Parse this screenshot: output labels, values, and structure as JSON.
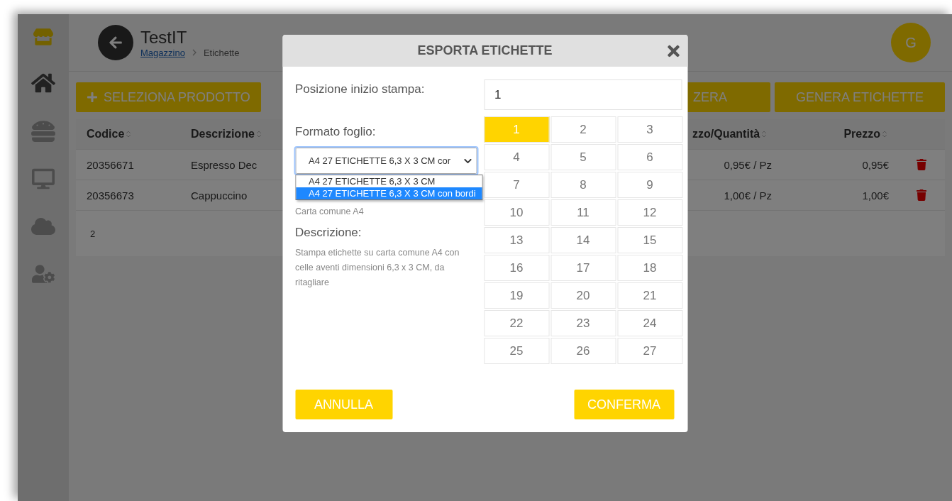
{
  "header": {
    "title": "TestIT",
    "breadcrumb": [
      {
        "label": "Magazzino",
        "link": true
      },
      {
        "label": "Etichette",
        "link": false
      }
    ],
    "avatar": "G"
  },
  "toolbar": {
    "add_button": "SELEZIONA PRODOTTO",
    "buttons": [
      "ZERA",
      "GENERA ETICHETTE"
    ]
  },
  "table": {
    "columns": [
      "Codice",
      "Descrizione",
      "zzo/Quantità",
      "Prezzo"
    ],
    "rows": [
      [
        "20356671",
        "Espresso Dec",
        "0,95€ / Pz",
        "0,95€"
      ],
      [
        "20356673",
        "Cappuccino",
        "1,00€ / Pz",
        "1,00€"
      ]
    ],
    "footer": "2"
  },
  "dialog": {
    "title": "ESPORTA ETICHETTE",
    "start_label": "Posizione inizio stampa:",
    "start_value": "1",
    "format_label": "Formato foglio:",
    "format_value": "A4 27 ETICHETTE 6,3 X 3 CM cor",
    "format_options": [
      {
        "label": "A4 27 ETICHETTE 6,3 X 3 CM",
        "selected": false
      },
      {
        "label": "A4 27 ETICHETTE 6,3 X 3 CM con bordi",
        "selected": true
      }
    ],
    "paper": "Carta comune A4",
    "description_label": "Descrizione:",
    "description": "Stampa etichette su carta comune A4 con celle aventi dimensioni 6,3 x 3 CM, da ritagliare",
    "positions": [
      {
        "label": "1",
        "selected": true
      },
      {
        "label": "2",
        "selected": false
      },
      {
        "label": "3",
        "selected": false
      },
      {
        "label": "4",
        "selected": false
      },
      {
        "label": "5",
        "selected": false
      },
      {
        "label": "6",
        "selected": false
      },
      {
        "label": "7",
        "selected": false
      },
      {
        "label": "8",
        "selected": false
      },
      {
        "label": "9",
        "selected": false
      },
      {
        "label": "10",
        "selected": false
      },
      {
        "label": "11",
        "selected": false
      },
      {
        "label": "12",
        "selected": false
      },
      {
        "label": "13",
        "selected": false
      },
      {
        "label": "14",
        "selected": false
      },
      {
        "label": "15",
        "selected": false
      },
      {
        "label": "16",
        "selected": false
      },
      {
        "label": "17",
        "selected": false
      },
      {
        "label": "18",
        "selected": false
      },
      {
        "label": "19",
        "selected": false
      },
      {
        "label": "20",
        "selected": false
      },
      {
        "label": "21",
        "selected": false
      },
      {
        "label": "22",
        "selected": false
      },
      {
        "label": "23",
        "selected": false
      },
      {
        "label": "24",
        "selected": false
      },
      {
        "label": "25",
        "selected": false
      },
      {
        "label": "26",
        "selected": false
      },
      {
        "label": "27",
        "selected": false
      }
    ],
    "cancel": "ANNULLA",
    "confirm": "CONFERMA"
  }
}
